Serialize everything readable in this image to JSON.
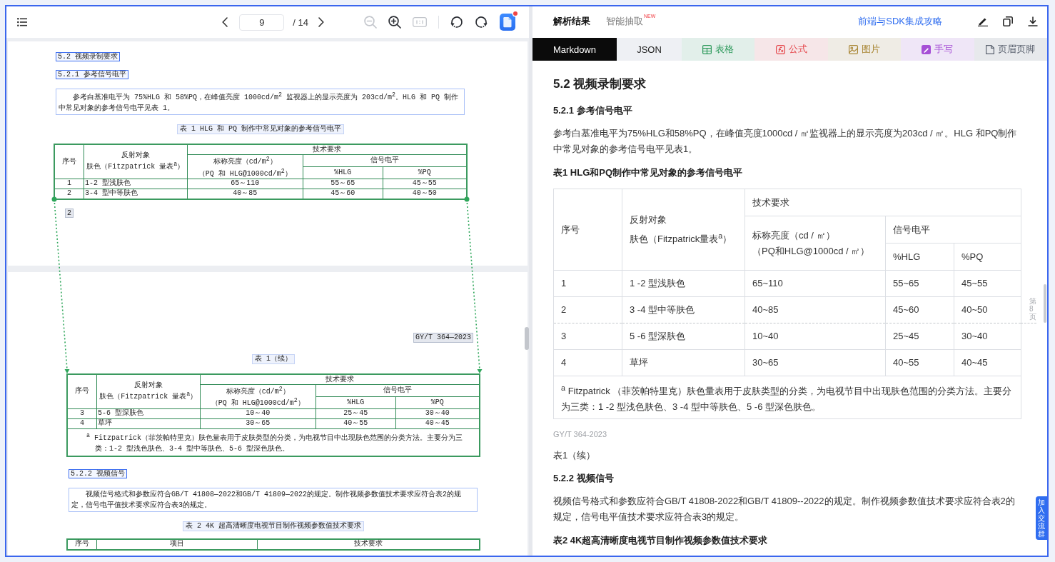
{
  "viewer_toolbar": {
    "page_input": "9",
    "page_total": "/ 14",
    "zoom_tools": [
      {
        "kind": "zoom_out",
        "disabled": true
      },
      {
        "kind": "zoom_in",
        "disabled": false
      },
      {
        "kind": "actual_size",
        "disabled": true
      }
    ],
    "rotate_tools": [
      {
        "kind": "rotate_left",
        "disabled": false
      },
      {
        "kind": "rotate_right",
        "disabled": false
      }
    ],
    "app_button": {
      "notification": true
    }
  },
  "document": {
    "pages": [
      {
        "blocks": [
          {
            "kind": "heading",
            "text": "5.2 视频录制要求"
          },
          {
            "kind": "heading",
            "text": "5.2.1 参考信号电平"
          },
          {
            "kind": "paragraph",
            "text": "参考白基准电平为 75%HLG 和 58%PQ，在峰值亮度 1000cd/m$^{2}$ 监视器上的显示亮度为 203cd/m$^{2}$。HLG 和 PQ 制作中常见对象的参考信号电平见表 1。"
          },
          {
            "kind": "caption",
            "text": "表 1 HLG 和 PQ 制作中常见对象的参考信号电平"
          },
          {
            "kind": "table",
            "continues": true,
            "header": {
              "number": "序号",
              "object": [
                "反射对象",
                "肤色（Fitzpatrick 量表$^{a}$）"
              ],
              "requirements": "技术要求",
              "luminance": [
                "标称亮度（cd/m$^{2}$）",
                "（PQ 和 HLG@1000cd/m$^{2}$）"
              ],
              "signal_level": "信号电平",
              "hlg": "%HLG",
              "pq": "%PQ"
            },
            "rows": [
              {
                "cells": [
                  "1",
                  "1-2 型浅肤色",
                  "65～110",
                  "55～65",
                  "45～55"
                ]
              },
              {
                "cells": [
                  "2",
                  "3-4 型中等肤色",
                  "40～85",
                  "45～60",
                  "40～50"
                ]
              }
            ]
          },
          {
            "kind": "page_number",
            "text": "2"
          }
        ]
      },
      {
        "blocks": [
          {
            "kind": "page_header",
            "text": "GY/T 364—2023"
          },
          {
            "kind": "caption",
            "text": "表 1（续）"
          },
          {
            "kind": "table",
            "continues": false,
            "header": {
              "number": "序号",
              "object": [
                "反射对象",
                "肤色（Fitzpatrick 量表$^{a}$）"
              ],
              "requirements": "技术要求",
              "luminance": [
                "标称亮度（cd/m$^{2}$）",
                "（PQ 和 HLG@1000cd/m$^{2}$）"
              ],
              "signal_level": "信号电平",
              "hlg": "%HLG",
              "pq": "%PQ"
            },
            "rows": [
              {
                "cells": [
                  "3",
                  "5-6 型深肤色",
                  "10～40",
                  "25～45",
                  "30～40"
                ]
              },
              {
                "cells": [
                  "4",
                  "草坪",
                  "30～65",
                  "40～55",
                  "40～45"
                ]
              }
            ],
            "footnote": "$^{a}$ Fitzpatrick（菲茨帕特里克）肤色量表用于皮肤类型的分类，为电视节目中出现肤色范围的分类方法。主要分为三类：1-2 型浅色肤色、3-4 型中等肤色、5-6 型深色肤色。"
          },
          {
            "kind": "heading",
            "text": "5.2.2 视频信号"
          },
          {
            "kind": "paragraph",
            "text": "视频信号格式和参数应符合GB/T 41808—2022和GB/T 41809—2022的规定。制作视频参数值技术要求应符合表2的规定，信号电平值技术要求应符合表3的规定。"
          },
          {
            "kind": "caption",
            "text": "表 2 4K 超高清晰度电视节目制作视频参数值技术要求"
          },
          {
            "kind": "table_head",
            "columns": [
              "序号",
              "项目",
              "技术要求"
            ]
          }
        ]
      }
    ]
  },
  "result_panel": {
    "tabs": [
      {
        "label": "解析结果",
        "selected": true
      },
      {
        "label": "智能抽取",
        "selected": false,
        "badge": "NEW"
      }
    ],
    "guide_link": "前端与SDK集成攻略",
    "format_tabs": [
      {
        "label": "Markdown",
        "kind": "markdown",
        "selected": true
      },
      {
        "label": "JSON",
        "kind": "json",
        "selected": false
      },
      {
        "label": "表格",
        "kind": "table",
        "color": "#2e9a5c",
        "selected": false
      },
      {
        "label": "公式",
        "kind": "formula",
        "color": "#e5484d",
        "selected": false
      },
      {
        "label": "图片",
        "kind": "image",
        "color": "#a98735",
        "selected": false
      },
      {
        "label": "手写",
        "kind": "handwriting",
        "color": "#a64fd6",
        "selected": false
      },
      {
        "label": "页眉页脚",
        "kind": "header_footer",
        "color": "#5c6370",
        "selected": false
      }
    ],
    "content": [
      {
        "kind": "h2",
        "text": "5.2 视频录制要求"
      },
      {
        "kind": "h3",
        "text": "5.2.1 参考信号电平"
      },
      {
        "kind": "p",
        "text": "参考白基准电平为75%HLG和58%PQ，在峰值亮度1000cd / ㎡监视器上的显示亮度为203cd / ㎡。HLG 和PQ制作中常见对象的参考信号电平见表1。"
      },
      {
        "kind": "table_title",
        "text": "表1 HLG和PQ制作中常见对象的参考信号电平"
      },
      {
        "kind": "table",
        "header": {
          "number": "序号",
          "object": [
            "反射对象",
            "肤色（Fitzpatrick量表$^{a}$）"
          ],
          "requirements": "技术要求",
          "luminance": [
            "标称亮度（cd / ㎡）",
            "（PQ和HLG@1000cd / ㎡）"
          ],
          "signal_level": "信号电平",
          "hlg": "%HLG",
          "pq": "%PQ"
        },
        "rows": [
          {
            "cells": [
              "1",
              "1 -2 型浅肤色",
              "65~110",
              "55~65",
              "45~55"
            ]
          },
          {
            "cells": [
              "2",
              "3 -4 型中等肤色",
              "40~85",
              "45~60",
              "40~50"
            ],
            "page_marker": "第8页"
          },
          {
            "cells": [
              "3",
              "5 -6 型深肤色",
              "10~40",
              "25~45",
              "30~40"
            ]
          },
          {
            "cells": [
              "4",
              "草坪",
              "30~65",
              "40~55",
              "40~45"
            ]
          }
        ],
        "footnote": "$^{a}$ Fitzpatrick （菲茨帕特里克）肤色量表用于皮肤类型的分类，为电视节目中出现肤色范围的分类方法。主要分为三类：1 -2 型浅色肤色、3 -4 型中等肤色、5 -6 型深色肤色。"
      },
      {
        "kind": "page_header",
        "text": "GY/T 364-2023"
      },
      {
        "kind": "p",
        "text": "表1（续）"
      },
      {
        "kind": "h3",
        "text": "5.2.2 视频信号"
      },
      {
        "kind": "p",
        "text": "视频信号格式和参数应符合GB/T 41808-2022和GB/T 41809--2022的规定。制作视频参数值技术要求应符合表2的规定，信号电平值技术要求应符合表3的规定。"
      },
      {
        "kind": "table_title",
        "text": "表2 4K超高清晰度电视节目制作视频参数值技术要求"
      }
    ],
    "side_tab": "加入交流群"
  }
}
